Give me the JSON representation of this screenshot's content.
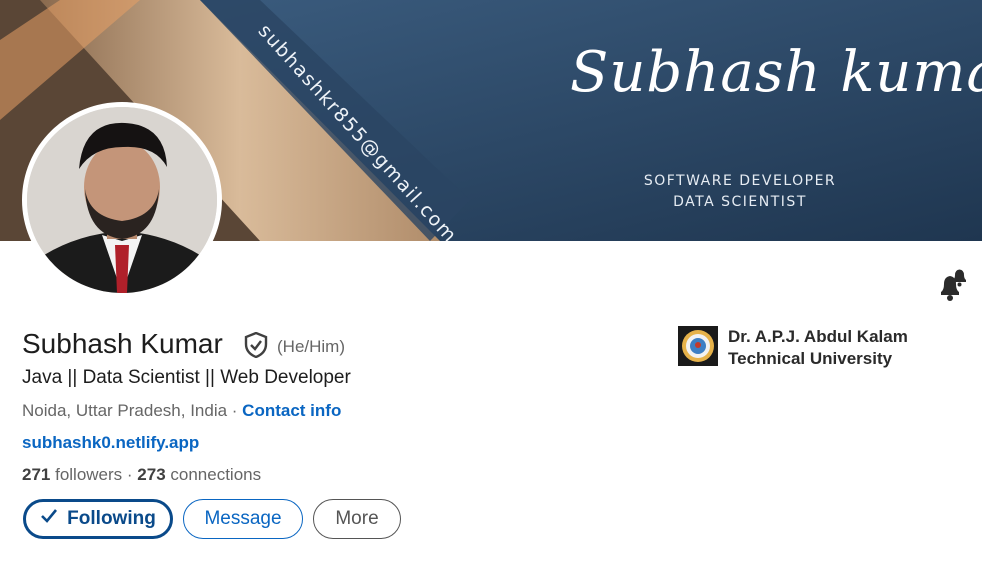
{
  "cover": {
    "email": "subhashkr855@gmail.com",
    "name": "Subhash kumar",
    "role_line1": "SOFTWARE DEVELOPER",
    "role_line2": "DATA SCIENTIST"
  },
  "profile": {
    "name": "Subhash Kumar",
    "pronouns": "(He/Him)",
    "headline": "Java || Data Scientist || Web Developer",
    "location": "Noida, Uttar Pradesh, India",
    "location_separator": " · ",
    "contact_label": "Contact info",
    "website": "subhashk0.netlify.app",
    "followers_count": "271",
    "followers_label": " followers",
    "stats_separator": " · ",
    "connections_count": "273",
    "connections_label": " connections"
  },
  "actions": {
    "following_label": "Following",
    "message_label": "Message",
    "more_label": "More"
  },
  "education": {
    "name": "Dr. A.P.J. Abdul Kalam Technical University"
  },
  "icons": {
    "verified": "verified-shield-icon",
    "bell": "notification-bell-icon",
    "check": "checkmark-icon"
  },
  "colors": {
    "link": "#0a66c2",
    "following_border": "#0a4a8a",
    "cover_base": "#2c4866"
  }
}
